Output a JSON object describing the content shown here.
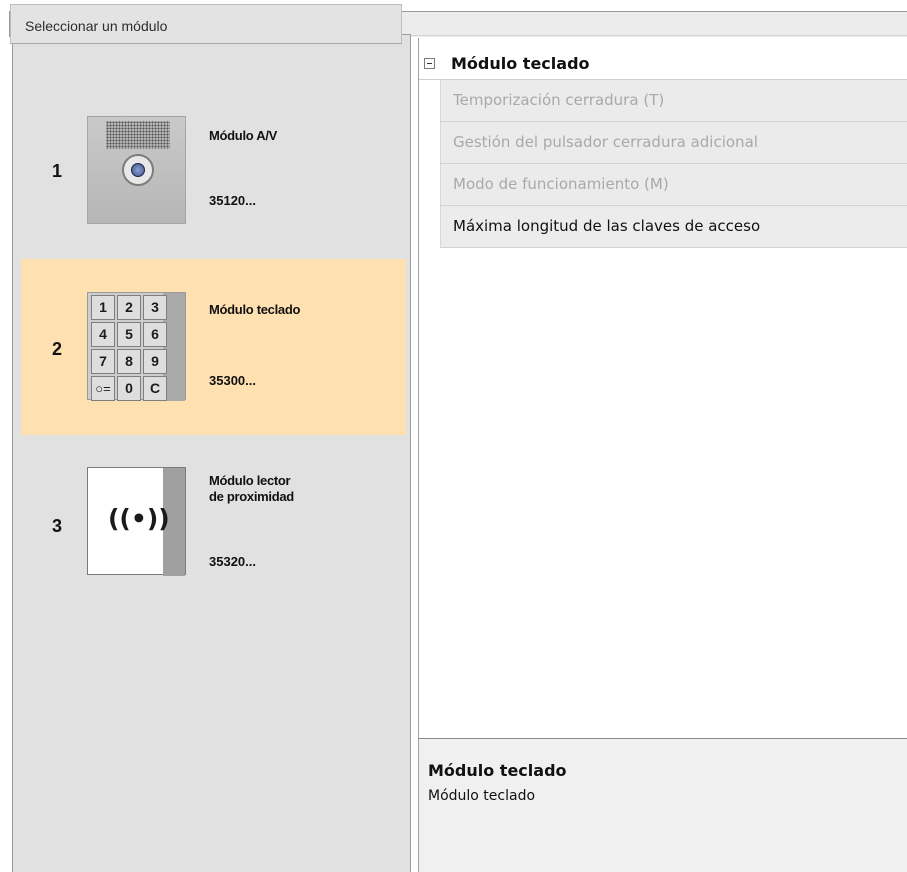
{
  "left_panel": {
    "header": "Seleccionar un módulo",
    "modules": [
      {
        "number": "1",
        "name": "Módulo A/V",
        "code": "35120...",
        "icon": "av-module-icon",
        "selected": false
      },
      {
        "number": "2",
        "name": "Módulo teclado",
        "code": "35300...",
        "icon": "keypad-module-icon",
        "selected": true
      },
      {
        "number": "3",
        "name_line1": "Módulo lector",
        "name_line2": "de proximidad",
        "code": "35320...",
        "icon": "proximity-reader-icon",
        "selected": false
      }
    ],
    "keypad_keys": [
      "1",
      "2",
      "3",
      "4",
      "5",
      "6",
      "7",
      "8",
      "9",
      "○=",
      "0",
      "C"
    ],
    "proximity_symbol": "((•))"
  },
  "property_panel": {
    "title": "Módulo teclado",
    "collapse_icon": "collapse-minus-icon",
    "rows": [
      {
        "label": "Temporización cerradura (T)",
        "enabled": false
      },
      {
        "label": "Gestión del pulsador cerradura adicional",
        "enabled": false
      },
      {
        "label": "Modo de funcionamiento (M)",
        "enabled": false
      },
      {
        "label": "Máxima longitud de las claves de acceso",
        "enabled": true
      }
    ]
  },
  "description": {
    "title": "Módulo teclado",
    "text": "Módulo teclado"
  },
  "colors": {
    "selected_background": "#ffe0b1",
    "panel_background": "#e1e1e1"
  }
}
